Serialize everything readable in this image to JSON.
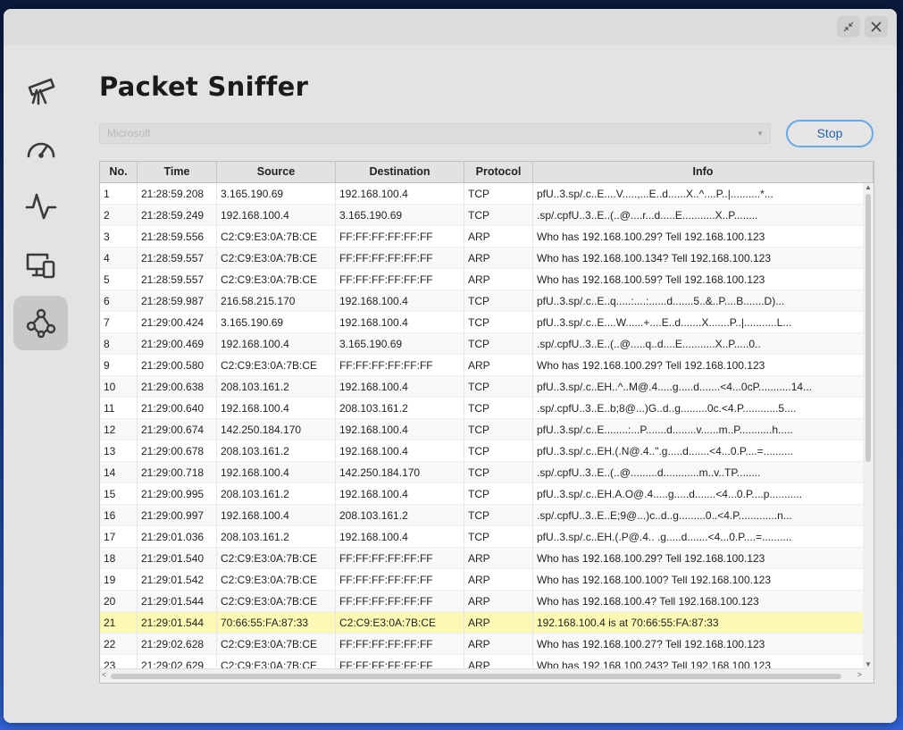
{
  "app": {
    "title": "Packet Sniffer"
  },
  "titlebar": {
    "minimize_icon": "collapse-icon",
    "close_icon": "close-icon"
  },
  "sidebar": {
    "items": [
      {
        "id": "telescope",
        "icon": "telescope-icon"
      },
      {
        "id": "speed",
        "icon": "speedometer-icon"
      },
      {
        "id": "activity",
        "icon": "pulse-icon"
      },
      {
        "id": "devices",
        "icon": "devices-icon"
      },
      {
        "id": "sniffer",
        "icon": "share-network-icon",
        "active": true
      }
    ]
  },
  "controls": {
    "interface_value": "Microsoft",
    "stop_label": "Stop"
  },
  "table": {
    "columns": [
      "No.",
      "Time",
      "Source",
      "Destination",
      "Protocol",
      "Info"
    ],
    "highlight_row": 21,
    "rows": [
      [
        "1",
        "21:28:59.208",
        "3.165.190.69",
        "192.168.100.4",
        "TCP",
        "pfU..3.sp/.c..E....V.....,...E..d......X..^....P..|..........*..."
      ],
      [
        "2",
        "21:28:59.249",
        "192.168.100.4",
        "3.165.190.69",
        "TCP",
        ".sp/.cpfU..3..E..(..@....r...d.....E...........X..P........"
      ],
      [
        "3",
        "21:28:59.556",
        "C2:C9:E3:0A:7B:CE",
        "FF:FF:FF:FF:FF:FF",
        "ARP",
        "Who has 192.168.100.29? Tell 192.168.100.123"
      ],
      [
        "4",
        "21:28:59.557",
        "C2:C9:E3:0A:7B:CE",
        "FF:FF:FF:FF:FF:FF",
        "ARP",
        "Who has 192.168.100.134? Tell 192.168.100.123"
      ],
      [
        "5",
        "21:28:59.557",
        "C2:C9:E3:0A:7B:CE",
        "FF:FF:FF:FF:FF:FF",
        "ARP",
        "Who has 192.168.100.59? Tell 192.168.100.123"
      ],
      [
        "6",
        "21:28:59.987",
        "216.58.215.170",
        "192.168.100.4",
        "TCP",
        "pfU..3.sp/.c..E..q.....:....:......d.......5..&..P....B.......D)..."
      ],
      [
        "7",
        "21:29:00.424",
        "3.165.190.69",
        "192.168.100.4",
        "TCP",
        "pfU..3.sp/.c..E....W......+....E..d.......X.......P..|...........L..."
      ],
      [
        "8",
        "21:29:00.469",
        "192.168.100.4",
        "3.165.190.69",
        "TCP",
        ".sp/.cpfU..3..E..(..@.....q..d....E...........X..P.....0.."
      ],
      [
        "9",
        "21:29:00.580",
        "C2:C9:E3:0A:7B:CE",
        "FF:FF:FF:FF:FF:FF",
        "ARP",
        "Who has 192.168.100.29? Tell 192.168.100.123"
      ],
      [
        "10",
        "21:29:00.638",
        "208.103.161.2",
        "192.168.100.4",
        "TCP",
        "pfU..3.sp/.c..EH..^..M@.4.....g.....d.......<4...0cP...........14..."
      ],
      [
        "11",
        "21:29:00.640",
        "192.168.100.4",
        "208.103.161.2",
        "TCP",
        ".sp/.cpfU..3..E..b;8@...)G..d..g.........0c.<4.P............5...."
      ],
      [
        "12",
        "21:29:00.674",
        "142.250.184.170",
        "192.168.100.4",
        "TCP",
        "pfU..3.sp/.c..E........:...P.......d........v......m..P...........h....."
      ],
      [
        "13",
        "21:29:00.678",
        "208.103.161.2",
        "192.168.100.4",
        "TCP",
        "pfU..3.sp/.c..EH.(.N@.4..\".g.....d.......<4...0.P....=.........."
      ],
      [
        "14",
        "21:29:00.718",
        "192.168.100.4",
        "142.250.184.170",
        "TCP",
        ".sp/.cpfU..3..E..(..@.........d............m..v..TP........"
      ],
      [
        "15",
        "21:29:00.995",
        "208.103.161.2",
        "192.168.100.4",
        "TCP",
        "pfU..3.sp/.c..EH.A.O@.4.....g.....d.......<4...0.P....p..........."
      ],
      [
        "16",
        "21:29:00.997",
        "192.168.100.4",
        "208.103.161.2",
        "TCP",
        ".sp/.cpfU..3..E..E;9@...)c..d..g.........0..<4.P.............n..."
      ],
      [
        "17",
        "21:29:01.036",
        "208.103.161.2",
        "192.168.100.4",
        "TCP",
        "pfU..3.sp/.c..EH.(.P@.4.. .g.....d.......<4...0.P....=.........."
      ],
      [
        "18",
        "21:29:01.540",
        "C2:C9:E3:0A:7B:CE",
        "FF:FF:FF:FF:FF:FF",
        "ARP",
        "Who has 192.168.100.29? Tell 192.168.100.123"
      ],
      [
        "19",
        "21:29:01.542",
        "C2:C9:E3:0A:7B:CE",
        "FF:FF:FF:FF:FF:FF",
        "ARP",
        "Who has 192.168.100.100? Tell 192.168.100.123"
      ],
      [
        "20",
        "21:29:01.544",
        "C2:C9:E3:0A:7B:CE",
        "FF:FF:FF:FF:FF:FF",
        "ARP",
        "Who has 192.168.100.4? Tell 192.168.100.123"
      ],
      [
        "21",
        "21:29:01.544",
        "70:66:55:FA:87:33",
        "C2:C9:E3:0A:7B:CE",
        "ARP",
        "192.168.100.4 is at 70:66:55:FA:87:33"
      ],
      [
        "22",
        "21:29:02.628",
        "C2:C9:E3:0A:7B:CE",
        "FF:FF:FF:FF:FF:FF",
        "ARP",
        "Who has 192.168.100.27? Tell 192.168.100.123"
      ],
      [
        "23",
        "21:29:02.629",
        "C2:C9:E3:0A:7B:CE",
        "FF:FF:FF:FF:FF:FF",
        "ARP",
        "Who has 192.168.100.243? Tell 192.168.100.123"
      ]
    ]
  },
  "colors": {
    "highlight": "#fcf9b4",
    "stop_border": "#67a9e4",
    "stop_text": "#2563a8"
  }
}
